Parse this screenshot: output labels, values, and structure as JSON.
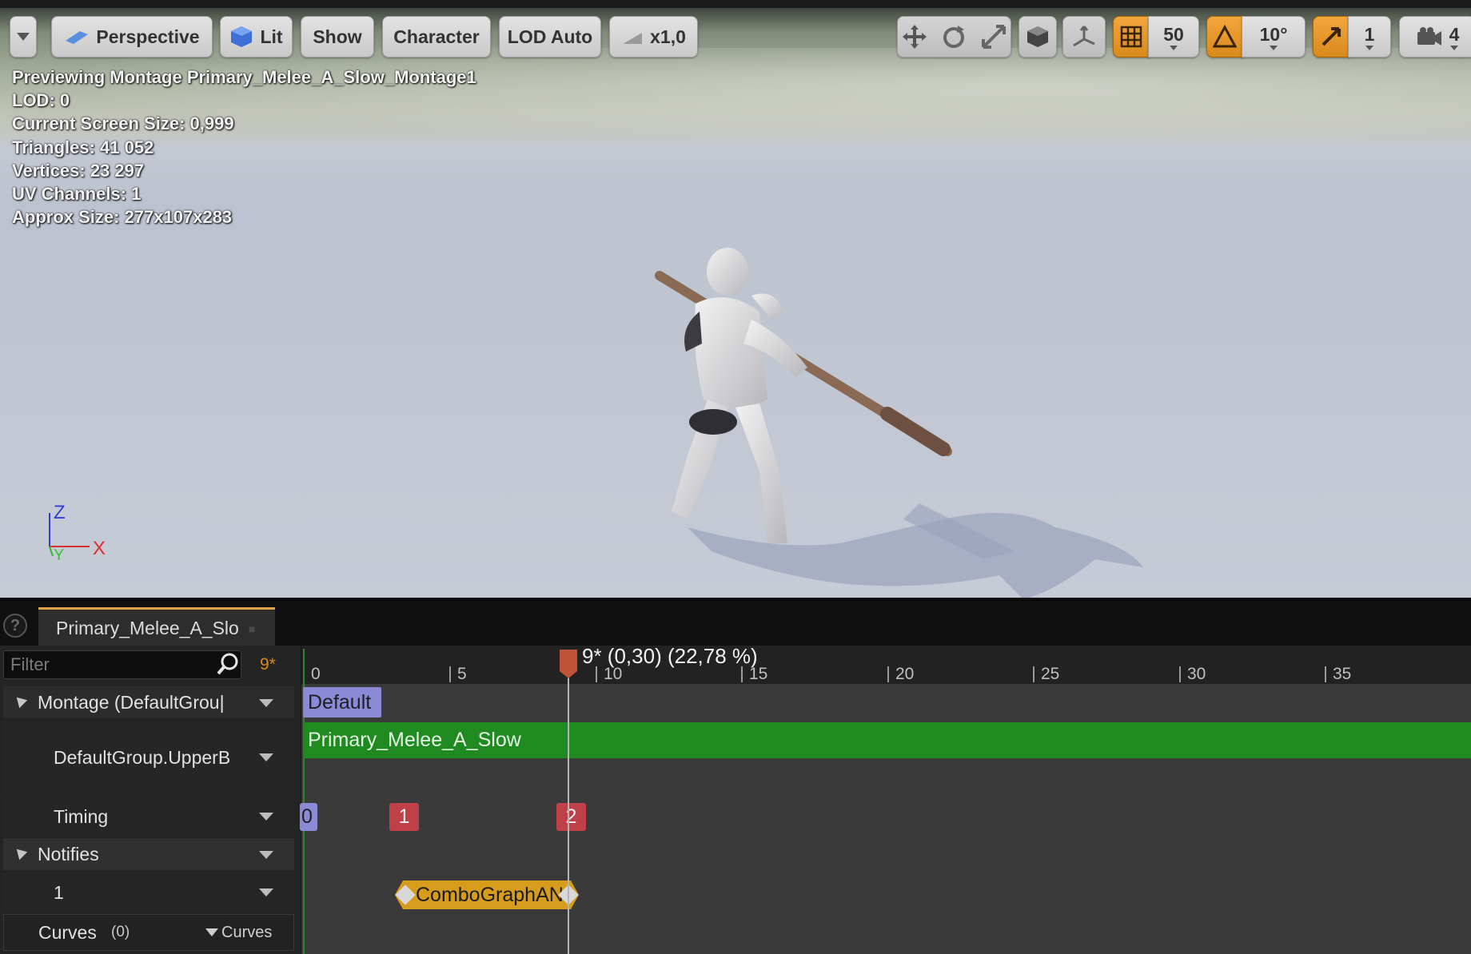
{
  "toolbar": {
    "perspective_label": "Perspective",
    "lit_label": "Lit",
    "show_label": "Show",
    "character_label": "Character",
    "lod_label": "LOD Auto",
    "speed_label": "x1,0",
    "grid_snap_value": "50",
    "rotation_snap_value": "10°",
    "camera_speed_value": "1",
    "scale_snap_value": "4"
  },
  "viewport": {
    "stats": [
      "Previewing Montage Primary_Melee_A_Slow_Montage1",
      "LOD: 0",
      "Current Screen Size: 0,999",
      "Triangles: 41 052",
      "Vertices: 23 297",
      "UV Channels: 1",
      "Approx Size: 277x107x283"
    ],
    "axis": {
      "z": "Z",
      "x": "X",
      "y": "Y"
    }
  },
  "tab": {
    "title": "Primary_Melee_A_Slo"
  },
  "left_panel": {
    "filter_placeholder": "Filter",
    "frame_marker": "9*",
    "rows": [
      {
        "label": "Montage (DefaultGrou|"
      },
      {
        "label": "DefaultGroup.UpperB"
      },
      {
        "label": "Timing"
      },
      {
        "label": "Notifies"
      },
      {
        "label": "1"
      },
      {
        "label": "Curves",
        "count": "(0)",
        "button": "Curves"
      }
    ]
  },
  "timeline": {
    "ruler_ticks": [
      "0",
      "5",
      "10",
      "15",
      "20",
      "25",
      "30",
      "35"
    ],
    "scrub_label": "9* (0,30) (22,78 %)",
    "section_label": "Default",
    "anim_segment": "Primary_Melee_A_Slow",
    "timing_markers": [
      "0",
      "1",
      "2"
    ],
    "notify_label": "ComboGraphAN"
  },
  "colors": {
    "accent_orange": "#d98a1c",
    "anim_green": "#1f8a1f",
    "section_purple": "#8a8ad6",
    "timing_red": "#c0404a"
  }
}
